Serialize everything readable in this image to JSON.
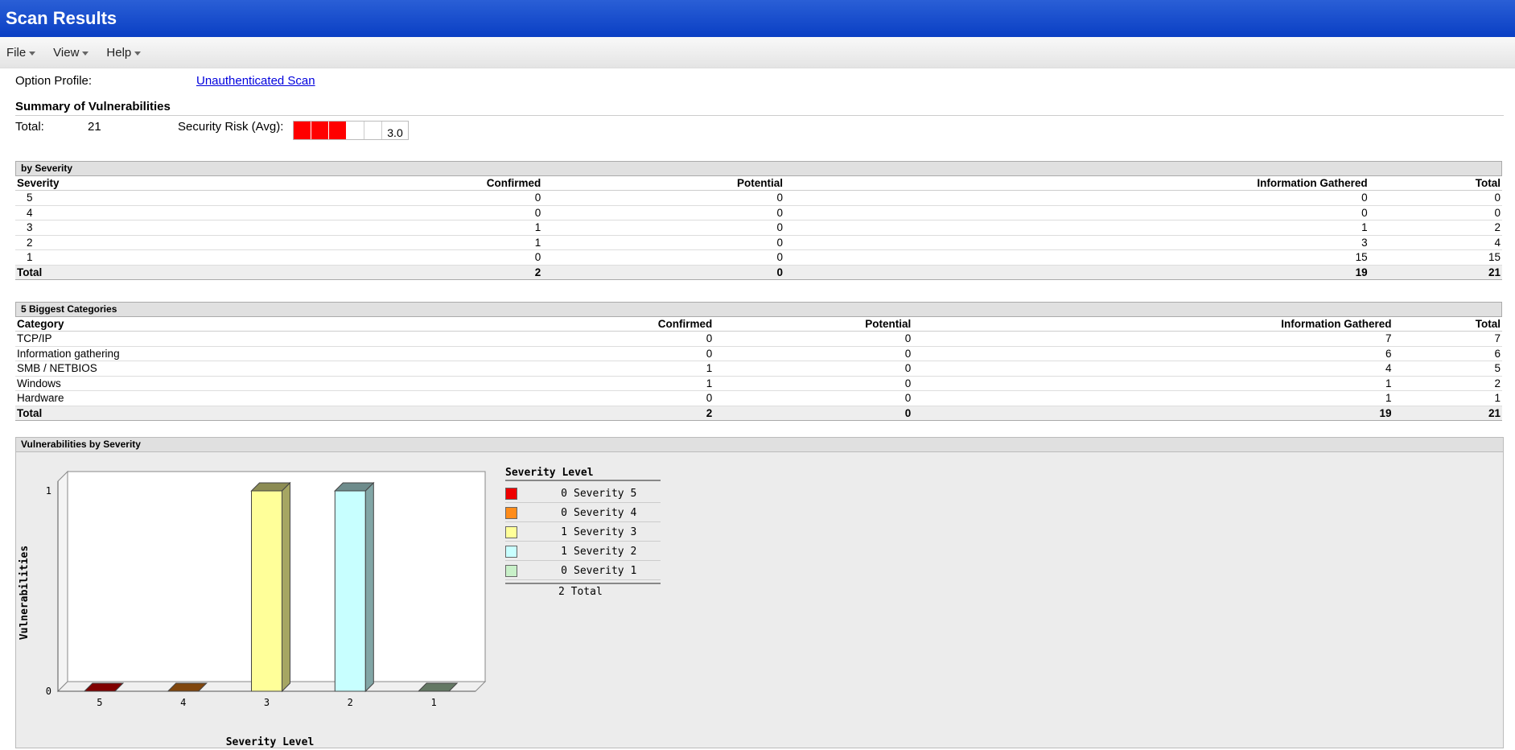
{
  "window": {
    "title": "Scan Results"
  },
  "menu": [
    {
      "label": "File"
    },
    {
      "label": "View"
    },
    {
      "label": "Help"
    }
  ],
  "option_profile": {
    "label": "Option Profile:",
    "value": "Unauthenticated Scan"
  },
  "summary": {
    "title": "Summary of Vulnerabilities",
    "total_label": "Total:",
    "total_value": "21",
    "risk_label": "Security Risk (Avg):",
    "risk_value": "3.0",
    "risk_filled": 3,
    "risk_cells": 5,
    "risk_color": "#ff0000"
  },
  "by_severity": {
    "title": "by Severity",
    "headers": [
      "Severity",
      "Confirmed",
      "Potential",
      "Information Gathered",
      "Total"
    ],
    "rows": [
      [
        "5",
        "0",
        "0",
        "0",
        "0"
      ],
      [
        "4",
        "0",
        "0",
        "0",
        "0"
      ],
      [
        "3",
        "1",
        "0",
        "1",
        "2"
      ],
      [
        "2",
        "1",
        "0",
        "3",
        "4"
      ],
      [
        "1",
        "0",
        "0",
        "15",
        "15"
      ]
    ],
    "total": [
      "Total",
      "2",
      "0",
      "19",
      "21"
    ]
  },
  "categories": {
    "title": "5 Biggest Categories",
    "headers": [
      "Category",
      "Confirmed",
      "Potential",
      "Information Gathered",
      "Total"
    ],
    "rows": [
      [
        "TCP/IP",
        "0",
        "0",
        "7",
        "7"
      ],
      [
        "Information gathering",
        "0",
        "0",
        "6",
        "6"
      ],
      [
        "SMB / NETBIOS",
        "1",
        "0",
        "4",
        "5"
      ],
      [
        "Windows",
        "1",
        "0",
        "1",
        "2"
      ],
      [
        "Hardware",
        "0",
        "0",
        "1",
        "1"
      ]
    ],
    "total": [
      "Total",
      "2",
      "0",
      "19",
      "21"
    ]
  },
  "chart_section": {
    "title": "Vulnerabilities by Severity"
  },
  "chart_data": {
    "type": "bar",
    "xlabel": "Severity Level",
    "ylabel": "Vulnerabilities",
    "categories": [
      "5",
      "4",
      "3",
      "2",
      "1"
    ],
    "values": [
      0,
      0,
      1,
      1,
      0
    ],
    "colors": [
      "#ff0000",
      "#ff8c1a",
      "#ffff99",
      "#c8ffff",
      "#c8f0c8"
    ],
    "y_ticks": [
      "0",
      "1"
    ],
    "ylim": [
      0,
      1
    ],
    "legend": {
      "title": "Severity Level",
      "items": [
        {
          "count": "0",
          "label": "Severity 5",
          "color": "#ee0000"
        },
        {
          "count": "0",
          "label": "Severity 4",
          "color": "#ff8c1a"
        },
        {
          "count": "1",
          "label": "Severity 3",
          "color": "#ffff99"
        },
        {
          "count": "1",
          "label": "Severity 2",
          "color": "#c8ffff"
        },
        {
          "count": "0",
          "label": "Severity 1",
          "color": "#c8f0c8"
        }
      ],
      "total": "2 Total"
    }
  }
}
